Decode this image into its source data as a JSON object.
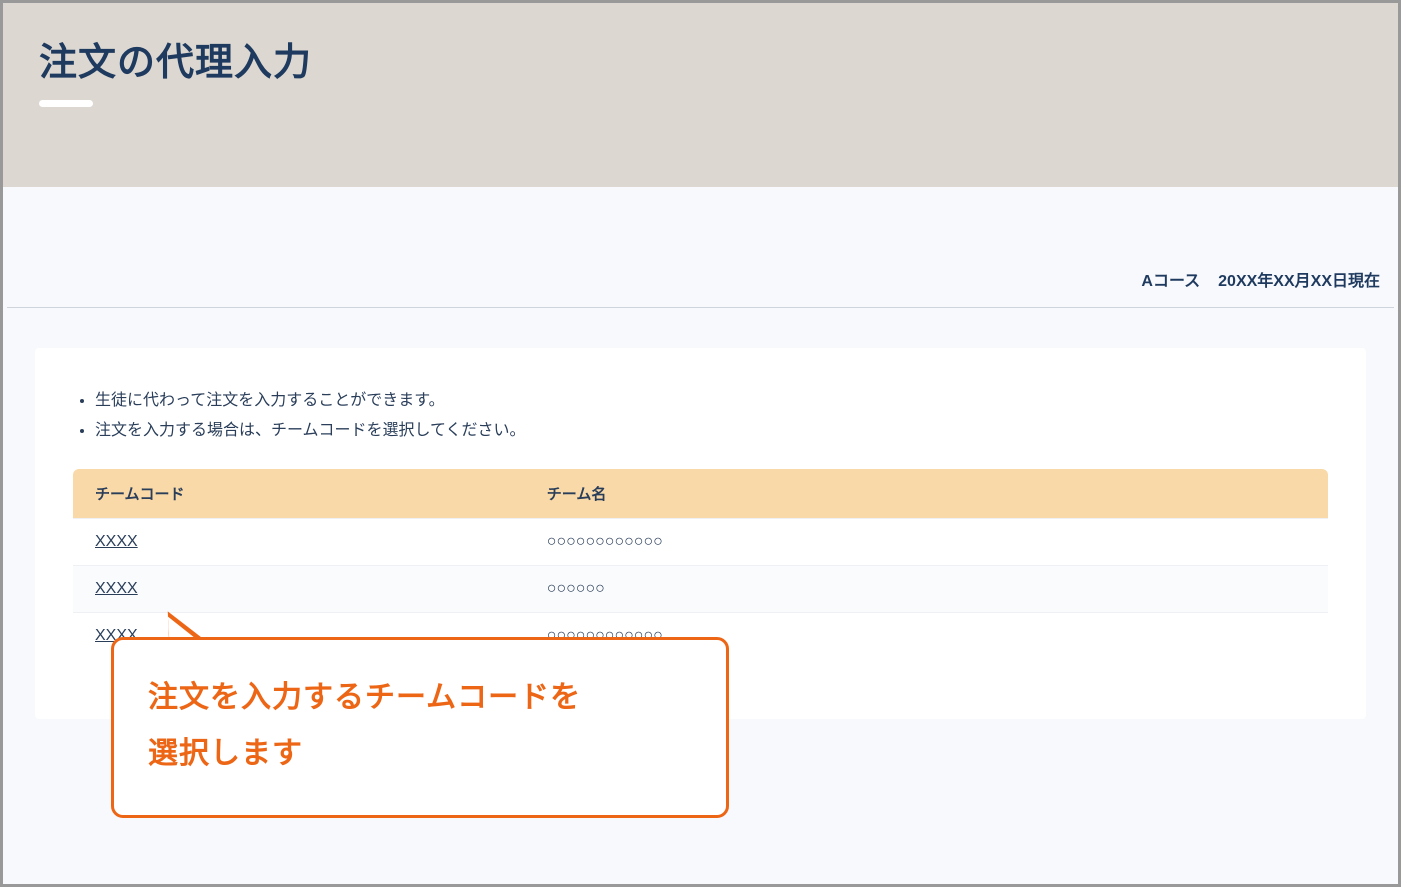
{
  "header": {
    "title": "注文の代理入力"
  },
  "meta": {
    "course": "Aコース",
    "asof": "20XX年XX月XX日現在"
  },
  "bullets": [
    "生徒に代わって注文を入力することができます。",
    "注文を入力する場合は、チームコードを選択してください。"
  ],
  "table": {
    "headers": {
      "code": "チームコード",
      "name": "チーム名"
    },
    "rows": [
      {
        "code": "XXXX",
        "name": "○○○○○○○○○○○○"
      },
      {
        "code": "XXXX",
        "name": "○○○○○○"
      },
      {
        "code": "XXXX",
        "name": "○○○○○○○○○○○○"
      }
    ]
  },
  "callout": {
    "line1": "注文を入力するチームコードを",
    "line2": "選択します"
  }
}
